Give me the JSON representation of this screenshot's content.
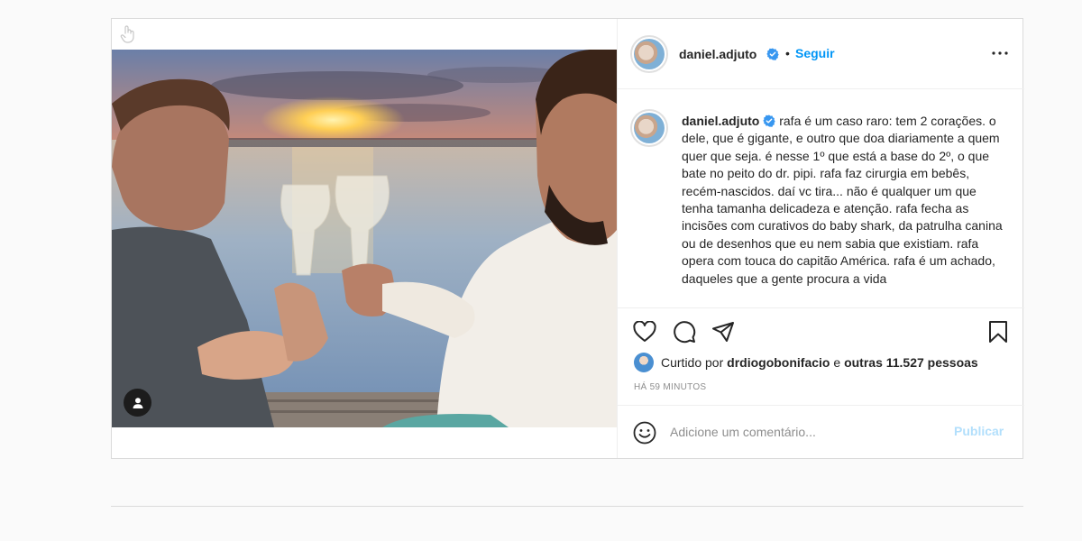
{
  "post": {
    "author": {
      "username": "daniel.adjuto",
      "verified": true
    },
    "follow_label": "Seguir",
    "header_separator": "•",
    "caption": "rafa é um caso raro: tem 2 corações. o dele, que é gigante, e outro que doa diariamente a quem quer que seja. é nesse 1º que está a base do 2º, o que bate no peito do dr. pipi. rafa faz cirurgia em bebês, recém-nascidos. daí vc tira... não é qualquer um que tenha tamanha delicadeza e atenção. rafa fecha as incisões com curativos do baby shark, da patrulha canina ou de desenhos que eu nem sabia que existiam. rafa opera com touca do capitão América. rafa é um achado, daqueles que a gente procura a vida",
    "likes": {
      "prefix": "Curtido por",
      "liker": "drdiogobonifacio",
      "connector": "e",
      "others": "outras 11.527 pessoas"
    },
    "timestamp": "HÁ 59 MINUTOS",
    "comment": {
      "placeholder": "Adicione um comentário...",
      "publish_label": "Publicar"
    }
  },
  "icons": {
    "hand": "hand-pointer-icon",
    "user_tag": "user-tag-icon",
    "verified": "verified-badge-icon",
    "more": "more-options-icon",
    "like": "heart-icon",
    "comment": "comment-icon",
    "share": "paper-plane-icon",
    "save": "bookmark-icon",
    "emoji": "emoji-icon"
  },
  "colors": {
    "link_blue": "#0095f6",
    "publish_disabled": "#b2dffc",
    "verified_blue": "#3897f0",
    "muted_text": "#8e8e8e",
    "border": "#dbdbdb"
  }
}
